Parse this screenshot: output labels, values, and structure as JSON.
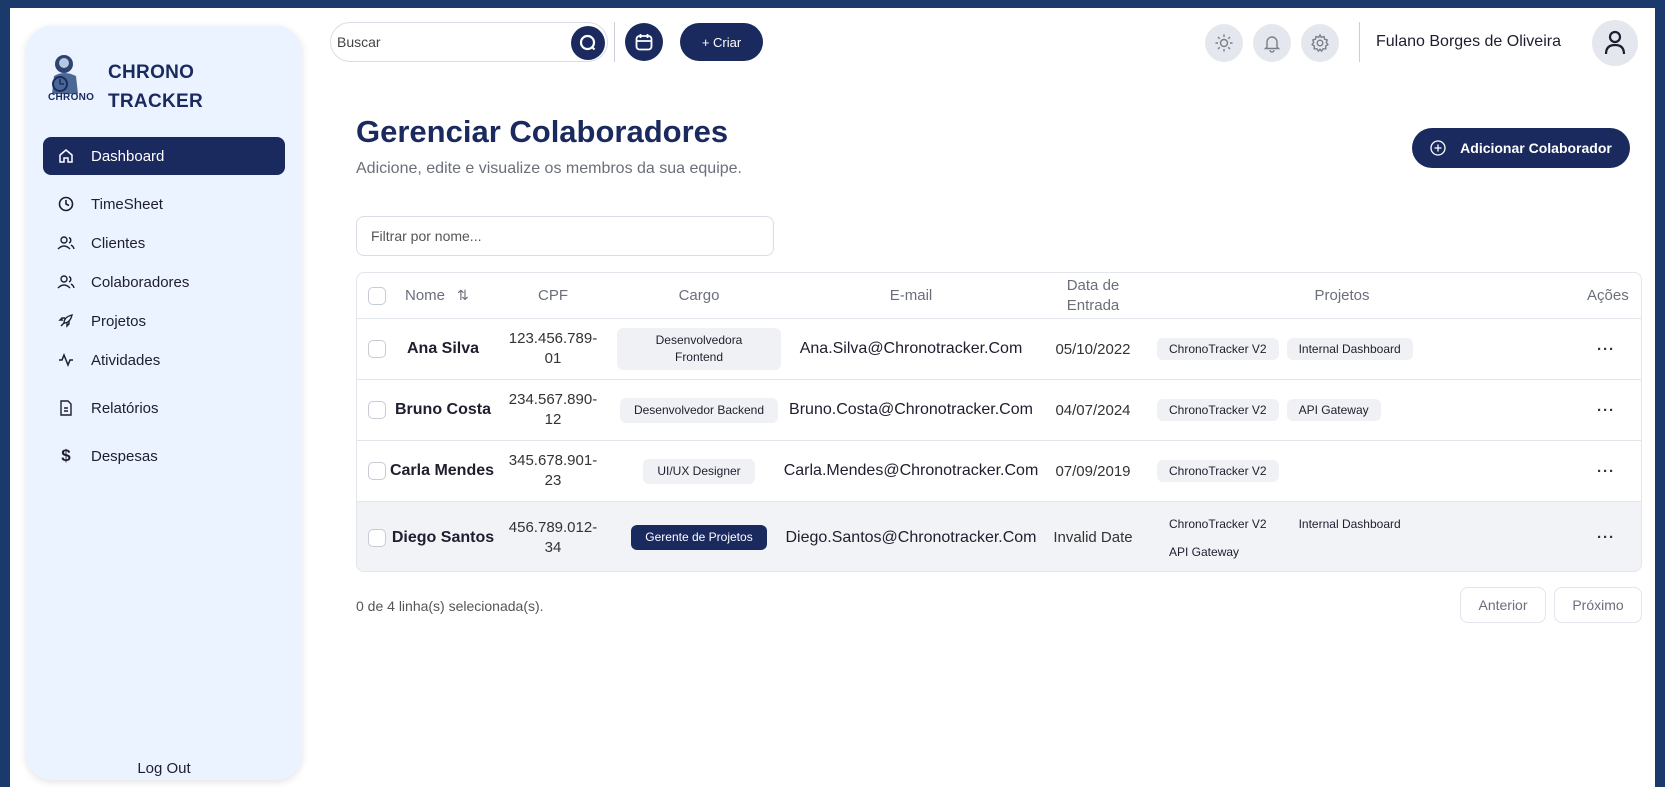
{
  "app": {
    "logo_line1": "CHRONO",
    "logo_line2": "TRACKER",
    "logo_mini": "CHRONO"
  },
  "sidebar": {
    "items": [
      {
        "label": "Dashboard",
        "icon": "home-icon",
        "active": true
      },
      {
        "label": "TimeSheet",
        "icon": "clock-icon"
      },
      {
        "label": "Clientes",
        "icon": "users-icon"
      },
      {
        "label": "Colaboradores",
        "icon": "users-icon"
      },
      {
        "label": "Projetos",
        "icon": "rocket-icon"
      },
      {
        "label": "Atividades",
        "icon": "activity-icon"
      },
      {
        "label": "Relatórios",
        "icon": "file-icon"
      },
      {
        "label": "Despesas",
        "icon": "dollar-icon"
      }
    ],
    "logout": "Log Out"
  },
  "topbar": {
    "search_placeholder": "Buscar",
    "create_label": "+ Criar",
    "username": "Fulano Borges de Oliveira"
  },
  "main": {
    "title": "Gerenciar Colaboradores",
    "subtitle": "Adicione, edite e visualize os membros da sua equipe.",
    "add_button": "Adicionar Colaborador",
    "filter_placeholder": "Filtrar por nome..."
  },
  "table": {
    "headers": {
      "nome": "Nome",
      "cpf": "CPF",
      "cargo": "Cargo",
      "email": "E-mail",
      "data": "Data de Entrada",
      "projetos": "Projetos",
      "acoes": "Ações"
    },
    "rows": [
      {
        "nome": "Ana Silva",
        "cpf": "123.456.789-01",
        "cargo": "Desenvolvedora Frontend",
        "email": "Ana.Silva@Chronotracker.Com",
        "data": "05/10/2022",
        "projetos": [
          "ChronoTracker V2",
          "Internal Dashboard"
        ],
        "acoes": "···"
      },
      {
        "nome": "Bruno Costa",
        "cpf": "234.567.890-12",
        "cargo": "Desenvolvedor Backend",
        "email": "Bruno.Costa@Chronotracker.Com",
        "data": "04/07/2024",
        "projetos": [
          "ChronoTracker V2",
          "API Gateway"
        ],
        "acoes": "···"
      },
      {
        "nome": "Carla Mendes",
        "cpf": "345.678.901-23",
        "cargo": "UI/UX Designer",
        "email": "Carla.Mendes@Chronotracker.Com",
        "data": "07/09/2019",
        "projetos": [
          "ChronoTracker V2"
        ],
        "acoes": "···"
      },
      {
        "nome": "Diego Santos",
        "cpf": "456.789.012-34",
        "cargo": "Gerente de Projetos",
        "email": "Diego.Santos@Chronotracker.Com",
        "data": "Invalid Date",
        "projetos": [
          "ChronoTracker V2",
          "Internal Dashboard",
          "API Gateway"
        ],
        "acoes": "···"
      }
    ],
    "selection_note": "0 de 4 linha(s) selecionada(s).",
    "prev_label": "Anterior",
    "next_label": "Próximo"
  },
  "colors": {
    "brand": "#1b2a5e",
    "background": "#1a3a6b",
    "sidebar": "#eaf3ff"
  }
}
